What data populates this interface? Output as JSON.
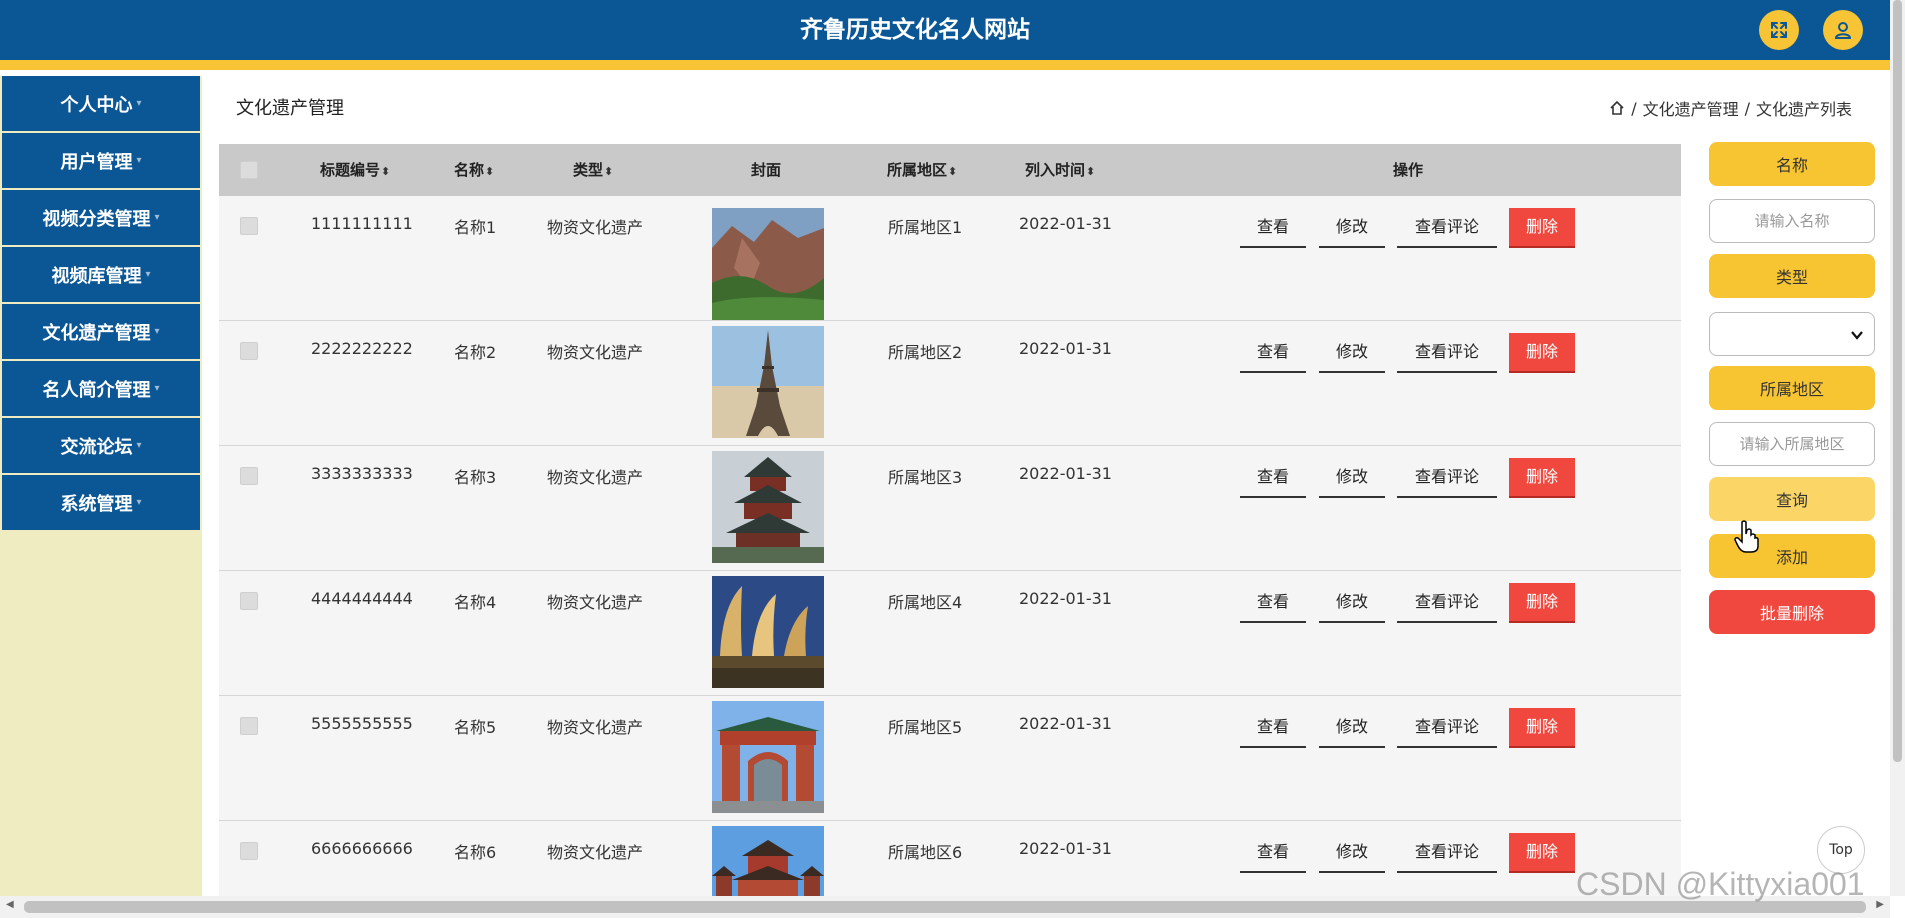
{
  "header": {
    "title": "齐鲁历史文化名人网站"
  },
  "sidebar": {
    "items": [
      {
        "label": "个人中心"
      },
      {
        "label": "用户管理"
      },
      {
        "label": "视频分类管理"
      },
      {
        "label": "视频库管理"
      },
      {
        "label": "文化遗产管理"
      },
      {
        "label": "名人简介管理"
      },
      {
        "label": "交流论坛"
      },
      {
        "label": "系统管理"
      }
    ]
  },
  "page": {
    "title": "文化遗产管理"
  },
  "breadcrumb": {
    "sep": "/",
    "level1": "文化遗产管理",
    "level2": "文化遗产列表"
  },
  "table": {
    "headers": {
      "code": "标题编号",
      "name": "名称",
      "type": "类型",
      "cover": "封面",
      "region": "所属地区",
      "date": "列入时间",
      "ops": "操作"
    },
    "actions": {
      "view": "查看",
      "edit": "修改",
      "comments": "查看评论",
      "delete": "删除"
    },
    "rows": [
      {
        "code": "1111111111",
        "name": "名称1",
        "type": "物资文化遗产",
        "region": "所属地区1",
        "date": "2022-01-31"
      },
      {
        "code": "2222222222",
        "name": "名称2",
        "type": "物资文化遗产",
        "region": "所属地区2",
        "date": "2022-01-31"
      },
      {
        "code": "3333333333",
        "name": "名称3",
        "type": "物资文化遗产",
        "region": "所属地区3",
        "date": "2022-01-31"
      },
      {
        "code": "4444444444",
        "name": "名称4",
        "type": "物资文化遗产",
        "region": "所属地区4",
        "date": "2022-01-31"
      },
      {
        "code": "5555555555",
        "name": "名称5",
        "type": "物资文化遗产",
        "region": "所属地区5",
        "date": "2022-01-31"
      },
      {
        "code": "6666666666",
        "name": "名称6",
        "type": "物资文化遗产",
        "region": "所属地区6",
        "date": "2022-01-31"
      }
    ]
  },
  "search": {
    "name_label": "名称",
    "name_placeholder": "请输入名称",
    "type_label": "类型",
    "type_value": "",
    "region_label": "所属地区",
    "region_placeholder": "请输入所属地区",
    "query": "查询",
    "add": "添加",
    "batch_delete": "批量删除"
  },
  "misc": {
    "top": "Top",
    "watermark": "CSDN @Kittyxia001"
  },
  "colors": {
    "primary": "#0b5796",
    "accent": "#f8c532",
    "danger": "#f0483e",
    "sidebar_bg": "#efecc1"
  }
}
